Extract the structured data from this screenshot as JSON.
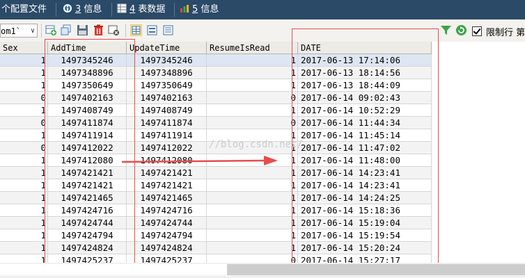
{
  "tabs": [
    {
      "prefix": "",
      "num": "",
      "label": "个配置文件",
      "icon": "config-icon"
    },
    {
      "prefix": "",
      "num": "3",
      "label": "信息",
      "icon": "info-icon"
    },
    {
      "prefix": "",
      "num": "4",
      "label": "表数据",
      "icon": "table-icon"
    },
    {
      "prefix": "",
      "num": "5",
      "label": "信息",
      "icon": "chart-icon"
    }
  ],
  "toolbar": {
    "combo_value": "om1`",
    "limit_label": "限制行",
    "limit_extra": "第",
    "icons": [
      "add-row-icon",
      "duplicate-row-icon",
      "save-icon",
      "delete-icon",
      "cancel-icon",
      "grid-view-icon",
      "form-view-icon",
      "text-view-icon",
      "filter-icon",
      "refresh-icon"
    ]
  },
  "table": {
    "columns": [
      "Sex",
      "AddTime",
      "UpdateTime",
      "ResumeIsRead",
      "DATE"
    ],
    "rows": [
      [
        "1",
        "1497345246",
        "1497345246",
        "1",
        "2017-06-13 17:14:06"
      ],
      [
        "1",
        "1497348896",
        "1497348896",
        "1",
        "2017-06-13 18:14:56"
      ],
      [
        "1",
        "1497350649",
        "1497350649",
        "1",
        "2017-06-13 18:44:09"
      ],
      [
        "0",
        "1497402163",
        "1497402163",
        "0",
        "2017-06-14 09:02:43"
      ],
      [
        "1",
        "1497408749",
        "1497408749",
        "1",
        "2017-06-14 10:52:29"
      ],
      [
        "0",
        "1497411874",
        "1497411874",
        "0",
        "2017-06-14 11:44:34"
      ],
      [
        "1",
        "1497411914",
        "1497411914",
        "1",
        "2017-06-14 11:45:14"
      ],
      [
        "0",
        "1497412022",
        "1497412022",
        "1",
        "2017-06-14 11:47:02"
      ],
      [
        "1",
        "1497412080",
        "1497412080",
        "1",
        "2017-06-14 11:48:00"
      ],
      [
        "1",
        "1497421421",
        "1497421421",
        "1",
        "2017-06-14 14:23:41"
      ],
      [
        "1",
        "1497421421",
        "1497421421",
        "1",
        "2017-06-14 14:23:41"
      ],
      [
        "1",
        "1497421465",
        "1497421465",
        "1",
        "2017-06-14 14:24:25"
      ],
      [
        "1",
        "1497424716",
        "1497424716",
        "1",
        "2017-06-14 15:18:36"
      ],
      [
        "1",
        "1497424744",
        "1497424744",
        "1",
        "2017-06-14 15:19:04"
      ],
      [
        "1",
        "1497424794",
        "1497424794",
        "1",
        "2017-06-14 15:19:54"
      ],
      [
        "1",
        "1497424824",
        "1497424824",
        "1",
        "2017-06-14 15:20:24"
      ],
      [
        "1",
        "1497425237",
        "1497425237",
        "0",
        "2017-06-14 15:27:17"
      ]
    ]
  },
  "watermark": "//blog.csdn.net/",
  "colors": {
    "tabbar": "#2b4a67",
    "annotation": "#e84c4c",
    "selected_row": "#dde6f3",
    "zebra": "#f3f3f3"
  }
}
